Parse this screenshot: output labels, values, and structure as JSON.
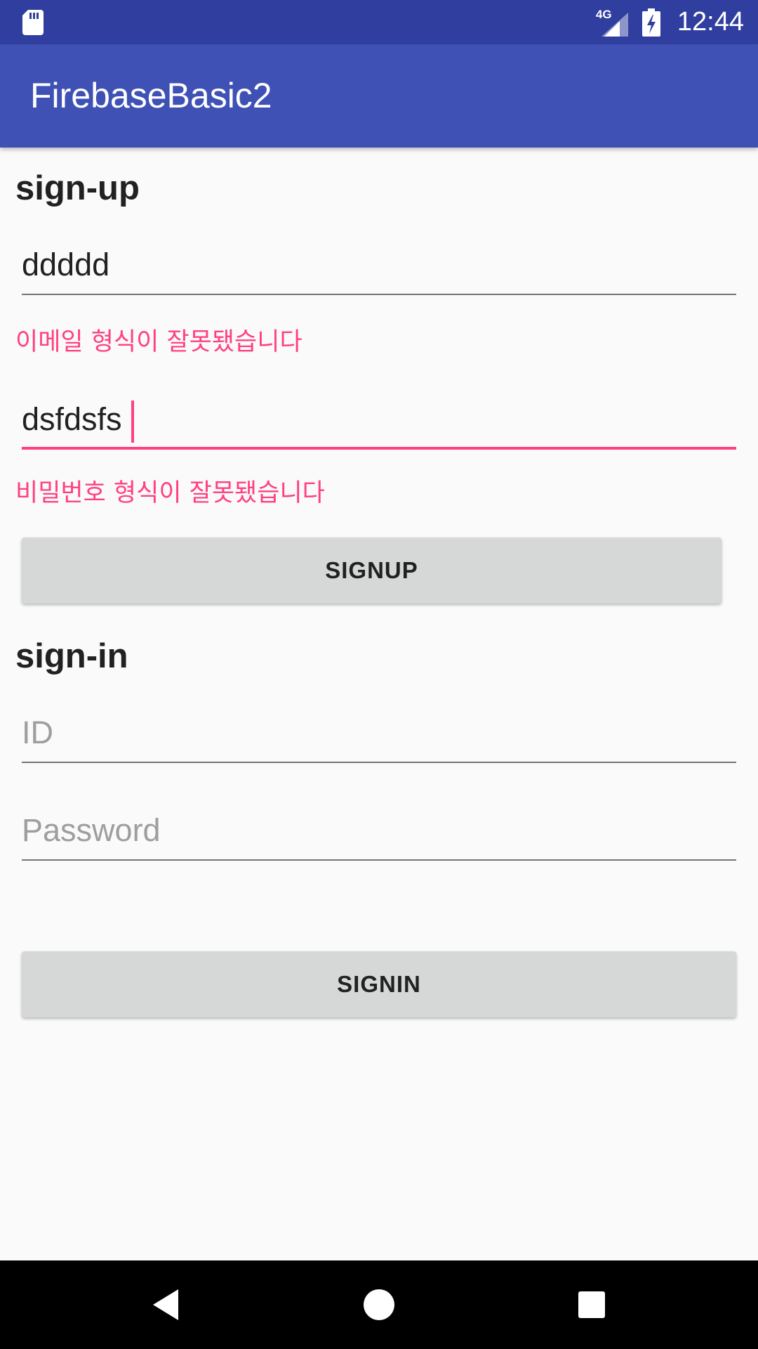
{
  "status_bar": {
    "time": "12:44",
    "network": "4G",
    "icons": [
      "sd-card-icon",
      "signal-icon",
      "battery-charging-icon"
    ]
  },
  "app_bar": {
    "title": "FirebaseBasic2"
  },
  "signup": {
    "title": "sign-up",
    "email_value": "ddddd",
    "email_error": "이메일 형식이 잘못됐습니다",
    "password_value": "dsfdsfs",
    "password_error": "비밀번호 형식이 잘못됐습니다",
    "button_label": "SIGNUP"
  },
  "signin": {
    "title": "sign-in",
    "id_placeholder": "ID",
    "password_placeholder": "Password",
    "button_label": "SIGNIN"
  },
  "nav_bar": {
    "icons": [
      "back-icon",
      "home-icon",
      "recents-icon"
    ]
  },
  "colors": {
    "status_bar": "#303F9F",
    "primary": "#3F51B5",
    "accent": "#FF4081",
    "background": "#FAFAFA",
    "button": "#D6D7D7"
  }
}
